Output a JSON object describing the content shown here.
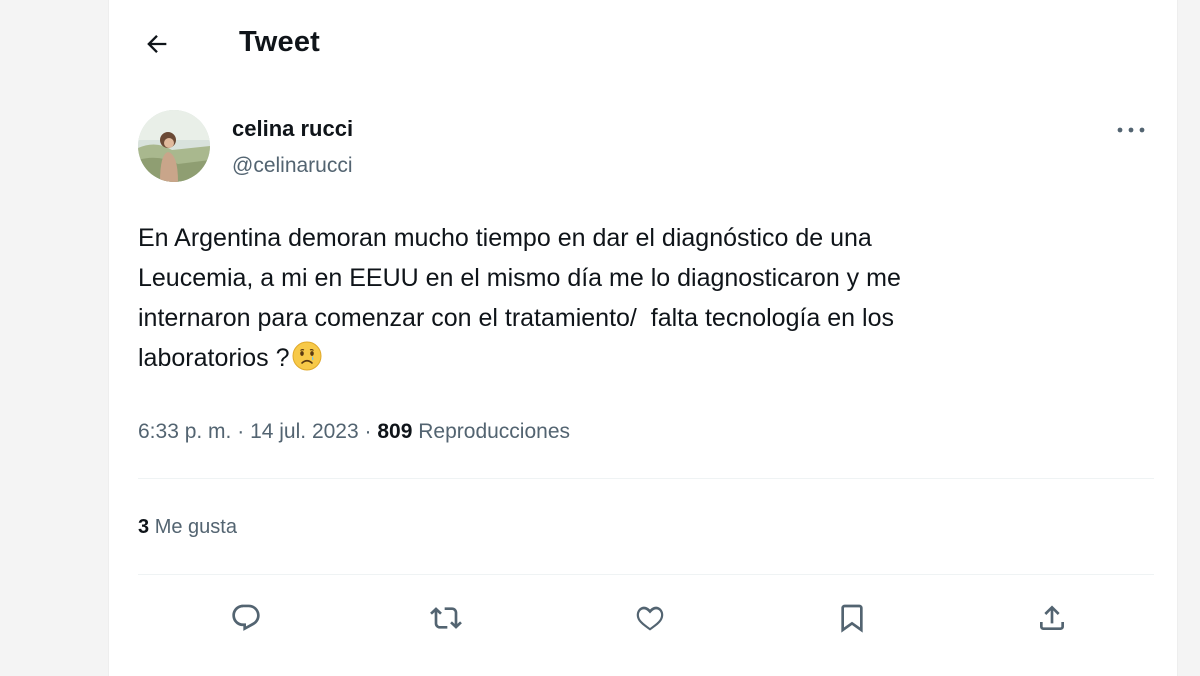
{
  "header": {
    "back_icon": "arrow-left-icon",
    "title": "Tweet"
  },
  "author": {
    "display_name": "celina rucci",
    "handle": "@celinarucci",
    "avatar_icon": "profile-photo"
  },
  "tweet": {
    "text": "En Argentina demoran mucho tiempo en dar el diagnóstico de una\nLeucemia, a mi en EEUU en el mismo día me lo diagnosticaron y me\ninternaron para comenzar con el tratamiento/  falta tecnología en los\nlaboratorios ?",
    "emoji_icon": "sad-face-emoji"
  },
  "meta": {
    "time": "6:33 p. m.",
    "separator": "·",
    "date": "14 jul. 2023",
    "views_count": "809",
    "views_label": "Reproducciones"
  },
  "stats": {
    "likes_count": "3",
    "likes_label": "Me gusta"
  },
  "actions": {
    "reply_icon": "reply-icon",
    "retweet_icon": "retweet-icon",
    "like_icon": "heart-icon",
    "bookmark_icon": "bookmark-icon",
    "share_icon": "share-icon"
  },
  "colors": {
    "text_primary": "#0f1419",
    "text_secondary": "#536471",
    "divider": "#eff3f4",
    "background": "#ffffff"
  }
}
